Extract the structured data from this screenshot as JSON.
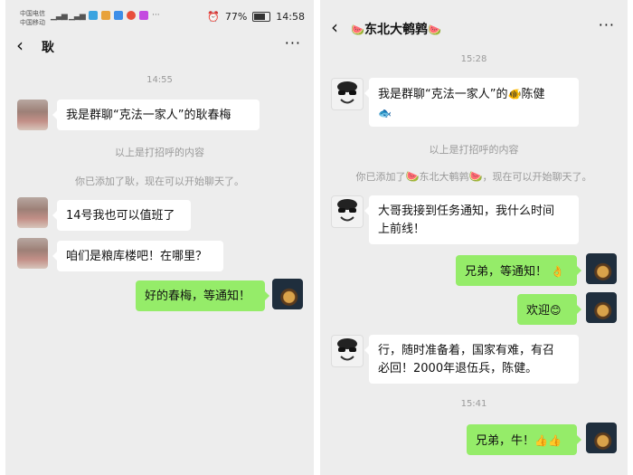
{
  "left": {
    "status": {
      "carrier_top": "中国电信",
      "carrier_bottom": "中国移动",
      "battery": "77%",
      "clock": "14:58"
    },
    "header": {
      "back_icon": "‹",
      "title": "耿",
      "more_icon": "···"
    },
    "timestamp": "14:55",
    "messages": [
      {
        "text": "我是群聊“克法一家人”的耿春梅"
      },
      {
        "text": "14号我也可以值班了"
      },
      {
        "text": "咱们是粮库楼吧！在哪里？"
      },
      {
        "text": "好的春梅，等通知！"
      }
    ],
    "system": [
      "以上是打招呼的内容",
      "你已添加了耿，现在可以开始聊天了。"
    ]
  },
  "right": {
    "header": {
      "back_icon": "‹",
      "title": "东北大鹌鹑",
      "title_emoji": "🍉",
      "more_icon": "···"
    },
    "timestamp1": "15:28",
    "timestamp2": "15:41",
    "messages": [
      {
        "text": "我是群聊“克法一家人”的",
        "emoji": "🐠",
        "text2": "陈健",
        "emoji2": "🐟"
      },
      {
        "text1": "大哥我接到任务通知，我什么时间",
        "text2": "上前线！"
      },
      {
        "text": "兄弟，等通知！",
        "emoji": "👌"
      },
      {
        "text": "欢迎",
        "emoji": "😊"
      },
      {
        "text1": "行，随时准备着，国家有难，有召",
        "text2": "必回！2000年退伍兵，陈健。"
      },
      {
        "text": "兄弟，牛！",
        "emoji": "👍👍"
      }
    ],
    "system": [
      "以上是打招呼的内容",
      {
        "prefix": "你已添加了",
        "emoji": "🍉",
        "name": "东北大鹌鹑",
        "suffix": "，现在可以开始聊天了。"
      }
    ]
  }
}
